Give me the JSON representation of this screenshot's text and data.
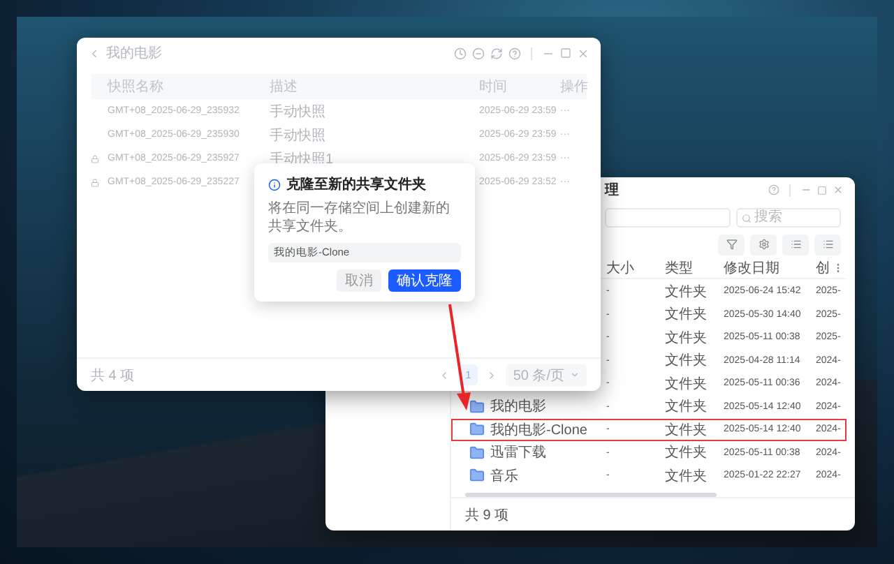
{
  "snapshot_window": {
    "title": "我的电影",
    "columns": [
      "快照名称",
      "描述",
      "时间",
      "操作"
    ],
    "rows": [
      {
        "name": "GMT+08_2025-06-29_235932",
        "description": "手动快照",
        "time": "2025-06-29 23:59",
        "actions": "···",
        "locked": false
      },
      {
        "name": "GMT+08_2025-06-29_235930",
        "description": "手动快照",
        "time": "2025-06-29 23:59",
        "actions": "···",
        "locked": false
      },
      {
        "name": "GMT+08_2025-06-29_235927",
        "description": "手动快照1",
        "time": "2025-06-29 23:59",
        "actions": "···",
        "locked": true
      },
      {
        "name": "GMT+08_2025-06-29_235227",
        "time": "2025-06-29 23:52",
        "actions": "···",
        "locked": true
      }
    ],
    "footer": "共 4 项",
    "pagination": {
      "pages": [
        {
          "label": "1",
          "selected": true
        }
      ],
      "page_size": "50 条/页"
    }
  },
  "dialog": {
    "title": "克隆至新的共享文件夹",
    "message": "将在同一存储空间上创建新的共享文件夹。",
    "input_value": "我的电影-Clone",
    "buttons": [
      {
        "label": "取消",
        "kind": "secondary"
      },
      {
        "label": "确认克隆",
        "kind": "primary"
      }
    ]
  },
  "file_window": {
    "title": "理",
    "search": {
      "placeholder": "搜索"
    },
    "columns": [
      "大小",
      "类型",
      "修改日期",
      "创"
    ],
    "rows": [
      {
        "size": "-",
        "type": "文件夹",
        "modified": "2025-06-24 15:42",
        "created": "2025-",
        "highlighted": false
      },
      {
        "size": "-",
        "type": "文件夹",
        "modified": "2025-05-30 14:40",
        "created": "2025-",
        "highlighted": false
      },
      {
        "size": "-",
        "type": "文件夹",
        "modified": "2025-05-11 00:38",
        "created": "2025-",
        "highlighted": false
      },
      {
        "size": "-",
        "type": "文件夹",
        "modified": "2025-04-28 11:14",
        "created": "2024-",
        "highlighted": false
      },
      {
        "size": "-",
        "type": "文件夹",
        "modified": "2025-05-11 00:36",
        "created": "2024-",
        "highlighted": false
      },
      {
        "name": "我的电影",
        "size": "-",
        "type": "文件夹",
        "modified": "2025-05-14 12:40",
        "created": "2024-",
        "highlighted": false
      },
      {
        "name": "我的电影-Clone",
        "size": "-",
        "type": "文件夹",
        "modified": "2025-05-14 12:40",
        "created": "2024-",
        "highlighted": true
      },
      {
        "name": "迅雷下载",
        "size": "-",
        "type": "文件夹",
        "modified": "2025-05-11 00:38",
        "created": "2024-",
        "highlighted": false
      },
      {
        "name": "音乐",
        "size": "-",
        "type": "文件夹",
        "modified": "2025-01-22 22:27",
        "created": "2024-",
        "highlighted": false
      }
    ],
    "footer": "共 9 项"
  }
}
